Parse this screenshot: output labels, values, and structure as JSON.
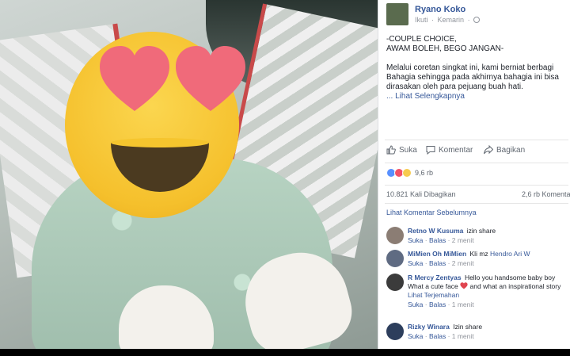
{
  "post": {
    "author": "Ryano Koko",
    "follow": "Ikuti",
    "time": "Kemarin",
    "title_line1": "-COUPLE CHOICE,",
    "title_line2": "AWAM BOLEH, BEGO JANGAN-",
    "body": "Melalui coretan singkat ini, kami berniat berbagi Bahagia sehingga pada akhirnya bahagia ini bisa dirasakan oleh para pejuang buah hati.",
    "see_more": "... Lihat Selengkapnya"
  },
  "actions": {
    "like": "Suka",
    "comment": "Komentar",
    "share": "Bagikan"
  },
  "reactions": {
    "count": "9,6 rb",
    "icons": [
      "like-icon",
      "love-icon",
      "wow-icon"
    ]
  },
  "stats": {
    "shares": "10.821 Kali Dibagikan",
    "comments": "2,6 rb Komentar"
  },
  "prev_comments": "Lihat Komentar Sebelumnya",
  "comments": [
    {
      "name": "Retno W Kusuma",
      "text": "izin share",
      "like": "Suka",
      "reply": "Balas",
      "time": "2 menit"
    },
    {
      "name": "MiMien Oh MiMien",
      "text": "Kli mz",
      "tag": "Hendro Ari W",
      "like": "Suka",
      "reply": "Balas",
      "time": "2 menit"
    },
    {
      "name": "R Mercy Zentyas",
      "text_before": "Hello you handsome baby boy What a cute face",
      "text_after": "and what an inspirational story",
      "translate": "Lihat Terjemahan",
      "like": "Suka",
      "reply": "Balas",
      "time": "1 menit"
    },
    {
      "name": "Rizky Winara",
      "text": "Izin share",
      "like": "Suka",
      "reply": "Balas",
      "time": "1 menit"
    }
  ],
  "colors": {
    "link": "#365899",
    "muted": "#90949c",
    "emoji_yellow": "#f5c02c",
    "heart_pink": "#f06a7a"
  }
}
